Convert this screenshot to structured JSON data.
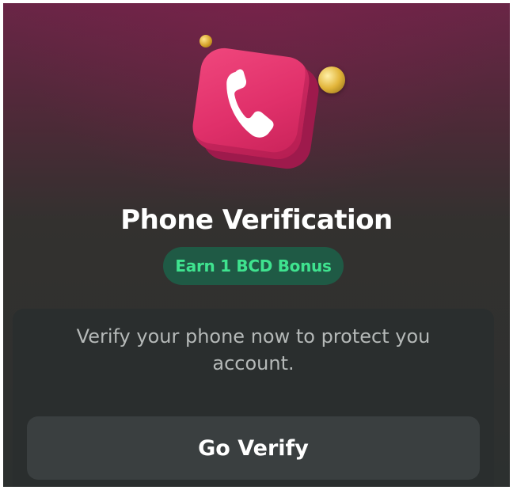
{
  "dialog": {
    "title": "Phone Verification",
    "bonus_badge": "Earn 1 BCD Bonus",
    "description": "Verify your phone now to protect you account.",
    "primary_button": "Go Verify",
    "hero_icon": "phone-icon",
    "decorations": [
      "gold-coin-icon",
      "gold-coin-icon"
    ]
  },
  "colors": {
    "accent_pink": "#e0306a",
    "bonus_green": "#3fe38f",
    "bonus_bg": "#1f5a45",
    "panel_bg": "#2a2e2e",
    "button_bg": "#3a3f40"
  }
}
